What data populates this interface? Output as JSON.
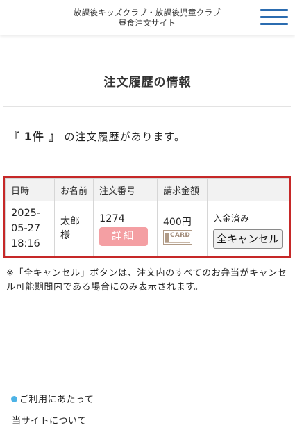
{
  "header": {
    "title_line1": "放課後キッズクラブ・放課後児童クラブ",
    "title_line2": "昼食注文サイト",
    "menu_icon": "hamburger-menu-icon",
    "menu_color": "#2b6cb0"
  },
  "page": {
    "title": "注文履歴の情報"
  },
  "summary": {
    "open_bracket": "『",
    "count": "1件",
    "close_bracket": "』",
    "text": "の注文履歴があります。"
  },
  "table": {
    "headers": [
      "日時",
      "お名前",
      "注文番号",
      "請求金額",
      ""
    ],
    "rows": [
      {
        "date_line1": "2025-",
        "date_line2": "05-27",
        "time": "18:16",
        "name": "太郎",
        "honorific": "様",
        "order_no": "1274",
        "detail_label": "詳細",
        "amount": "400円",
        "payment_icon": "card-payment-icon",
        "payment_label": "CARD",
        "status": "入金済み",
        "cancel_label": "全キャンセル"
      }
    ],
    "highlight_color": "#c62828",
    "detail_color": "#f49fa3"
  },
  "note": "※「全キャンセル」ボタンは、注文内のすべてのお弁当がキャンセル可能期間内である場合にのみ表示されます。",
  "footer": {
    "link1": "ご利用にあたって",
    "link1_icon": "blue-dot-icon",
    "link2": "当サイトについて"
  }
}
